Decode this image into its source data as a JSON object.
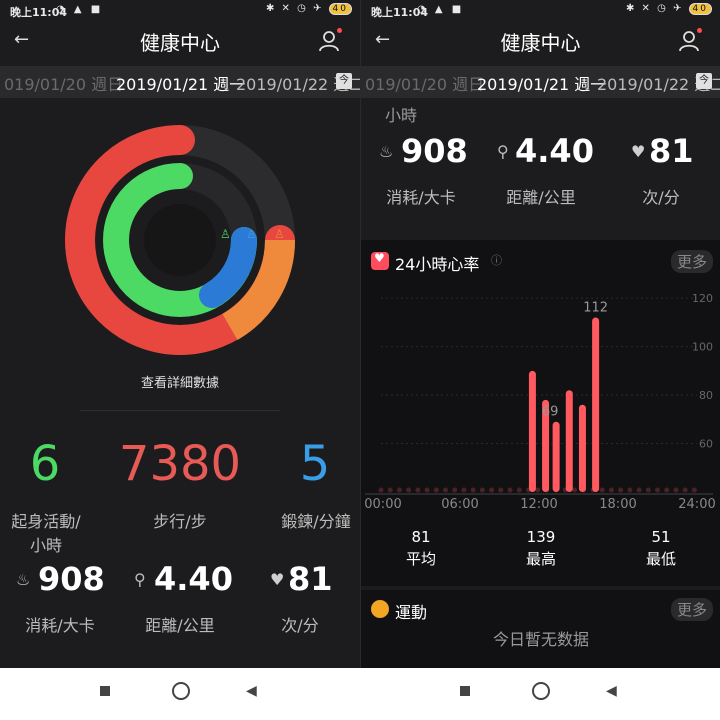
{
  "status": {
    "time": "晚上11:04",
    "battery": "40"
  },
  "nav": {
    "title": "健康中心"
  },
  "dates": {
    "prev": "019/01/20 週日",
    "current": "2019/01/21 週一",
    "next": "2019/01/22 週二"
  },
  "rings": {
    "colors": {
      "outer": "#e8473f",
      "middle": "#4cd964",
      "inner": "#2b7bd6"
    }
  },
  "detail_link": "查看詳細數據",
  "goals": [
    {
      "value": "6",
      "label_line1": "起身活動/",
      "label_line2": "小時",
      "color": "#4cd964"
    },
    {
      "value": "7380",
      "label_line1": "步行/步",
      "label_line2": "",
      "color": "#e85a55"
    },
    {
      "value": "5",
      "label_line1": "鍛鍊/分鐘",
      "label_line2": "",
      "color": "#3a9ee6"
    }
  ],
  "summary": [
    {
      "value": "908",
      "label": "消耗/大卡",
      "icon": "flame-icon"
    },
    {
      "value": "4.40",
      "label": "距離/公里",
      "icon": "route-icon"
    },
    {
      "value": "81",
      "label": "次/分",
      "icon": "heart-icon"
    }
  ],
  "right_top_label": "小時",
  "heart_section": {
    "title": "24小時心率",
    "more": "更多",
    "stats": [
      {
        "value": "81",
        "label": "平均"
      },
      {
        "value": "139",
        "label": "最高"
      },
      {
        "value": "51",
        "label": "最低"
      }
    ]
  },
  "chart_data": {
    "type": "bar",
    "title": "24小時心率",
    "x_ticks": [
      "00:00",
      "06:00",
      "12:00",
      "18:00",
      "24:00"
    ],
    "y_ticks": [
      "120",
      "100",
      "80",
      "60"
    ],
    "ylim": [
      40,
      125
    ],
    "bars": [
      {
        "hour": 11.5,
        "value": 90
      },
      {
        "hour": 12.5,
        "value": 78
      },
      {
        "hour": 13.3,
        "value": 69
      },
      {
        "hour": 14.3,
        "value": 82
      },
      {
        "hour": 15.3,
        "value": 76
      },
      {
        "hour": 16.3,
        "value": 112
      }
    ],
    "bar_color": "#ff5a5f",
    "data_labels": [
      {
        "text": "112",
        "value": 112
      },
      {
        "text": "69",
        "value": 69
      }
    ]
  },
  "exercise_section": {
    "title": "運動",
    "more": "更多",
    "empty_text": "今日暫无数据"
  }
}
